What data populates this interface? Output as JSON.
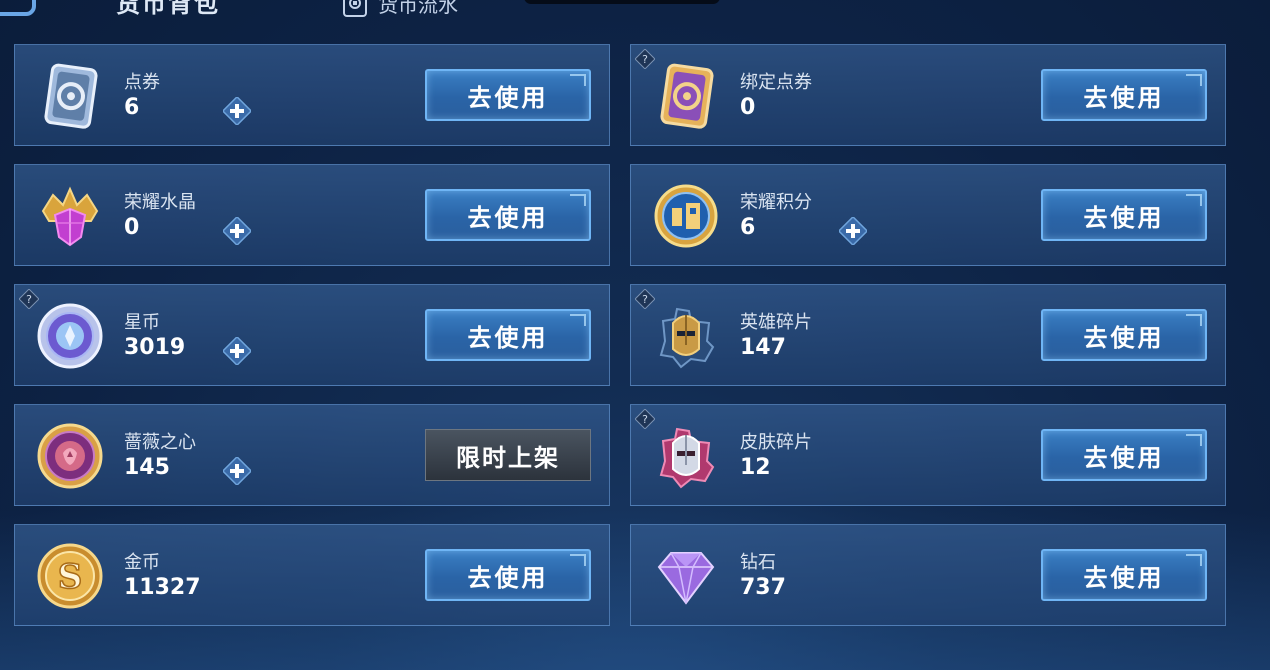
{
  "header": {
    "active_tab": "货币背包",
    "flow_tab": "货币流水"
  },
  "colors": {
    "accent_blue": "#2f6fb5",
    "button_border": "#6fb5f5"
  },
  "currencies": [
    {
      "name": "点券",
      "value": "6",
      "icon": "coupon-ticket-icon",
      "has_plus": true,
      "has_help": false,
      "button": "去使用"
    },
    {
      "name": "绑定点券",
      "value": "0",
      "icon": "bound-coupon-ticket-icon",
      "has_plus": false,
      "has_help": true,
      "button": "去使用"
    },
    {
      "name": "荣耀水晶",
      "value": "0",
      "icon": "glory-crystal-icon",
      "has_plus": true,
      "has_help": false,
      "button": "去使用"
    },
    {
      "name": "荣耀积分",
      "value": "6",
      "icon": "glory-points-icon",
      "has_plus": true,
      "has_help": false,
      "button": "去使用"
    },
    {
      "name": "星币",
      "value": "3019",
      "icon": "star-coin-icon",
      "has_plus": true,
      "has_help": true,
      "button": "去使用"
    },
    {
      "name": "英雄碎片",
      "value": "147",
      "icon": "hero-fragment-icon",
      "has_plus": false,
      "has_help": true,
      "button": "去使用"
    },
    {
      "name": "蔷薇之心",
      "value": "145",
      "icon": "rose-heart-icon",
      "has_plus": true,
      "has_help": false,
      "button": "限时上架"
    },
    {
      "name": "皮肤碎片",
      "value": "12",
      "icon": "skin-fragment-icon",
      "has_plus": false,
      "has_help": true,
      "button": "去使用"
    },
    {
      "name": "金币",
      "value": "11327",
      "icon": "gold-coin-icon",
      "has_plus": false,
      "has_help": false,
      "button": "去使用"
    },
    {
      "name": "钻石",
      "value": "737",
      "icon": "diamond-icon",
      "has_plus": false,
      "has_help": false,
      "button": "去使用"
    }
  ]
}
